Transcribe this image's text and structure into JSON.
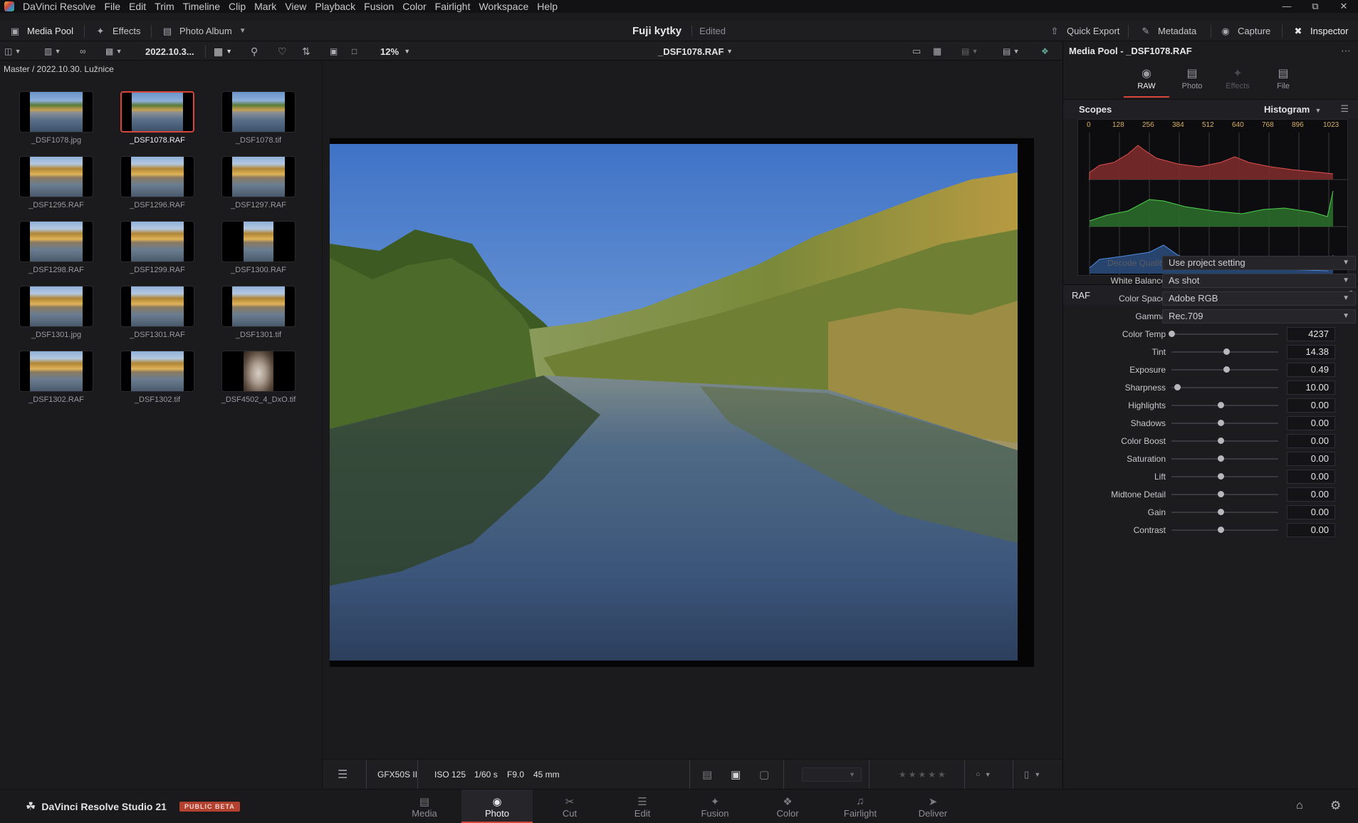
{
  "menubar": {
    "items": [
      "DaVinci Resolve",
      "File",
      "Edit",
      "Trim",
      "Timeline",
      "Clip",
      "Mark",
      "View",
      "Playback",
      "Fusion",
      "Color",
      "Fairlight",
      "Workspace",
      "Help"
    ]
  },
  "toolbar": {
    "media_pool": "Media Pool",
    "effects": "Effects",
    "photo_album": "Photo Album",
    "project_title": "Fuji kytky",
    "edited": "Edited",
    "quick_export": "Quick Export",
    "metadata": "Metadata",
    "capture": "Capture",
    "inspector": "Inspector"
  },
  "subbar": {
    "bin": "2022.10.3...",
    "zoom": "12%",
    "clip_name": "_DSF1078.RAF"
  },
  "pool": {
    "breadcrumb": "Master / 2022.10.30. Lužnice",
    "items": [
      {
        "name": "_DSF1078.jpg",
        "selected": false
      },
      {
        "name": "_DSF1078.RAF",
        "selected": true
      },
      {
        "name": "_DSF1078.tif",
        "selected": false
      },
      {
        "name": "_DSF1295.RAF",
        "selected": false
      },
      {
        "name": "_DSF1296.RAF",
        "selected": false
      },
      {
        "name": "_DSF1297.RAF",
        "selected": false
      },
      {
        "name": "_DSF1298.RAF",
        "selected": false
      },
      {
        "name": "_DSF1299.RAF",
        "selected": false
      },
      {
        "name": "_DSF1300.RAF",
        "selected": false
      },
      {
        "name": "_DSF1301.jpg",
        "selected": false
      },
      {
        "name": "_DSF1301.RAF",
        "selected": false
      },
      {
        "name": "_DSF1301.tif",
        "selected": false
      },
      {
        "name": "_DSF1302.RAF",
        "selected": false
      },
      {
        "name": "_DSF1302.tif",
        "selected": false
      },
      {
        "name": "_DSF4502_4_DxO.tif",
        "selected": false
      }
    ]
  },
  "viewer_bar": {
    "camera": "GFX50S II",
    "iso": "ISO 125",
    "shutter": "1/60 s",
    "aperture": "F9.0",
    "focal": "45 mm"
  },
  "inspector": {
    "title": "Media Pool - _DSF1078.RAF",
    "tabs": [
      {
        "label": "RAW",
        "state": "active",
        "icon": "raw-camera-icon"
      },
      {
        "label": "Photo",
        "state": "normal",
        "icon": "photo-icon"
      },
      {
        "label": "Effects",
        "state": "disabled",
        "icon": "effects-wand-icon"
      },
      {
        "label": "File",
        "state": "normal",
        "icon": "file-icon"
      }
    ],
    "scopes_label": "Scopes",
    "scope_type": "Histogram",
    "histogram_ticks": [
      "0",
      "128",
      "256",
      "384",
      "512",
      "640",
      "768",
      "896",
      "1023"
    ],
    "section": "RAF",
    "dropdowns": [
      {
        "label": "Decode Quality",
        "value": "Use project setting",
        "dim": true
      },
      {
        "label": "White Balance",
        "value": "As shot",
        "dim": false
      },
      {
        "label": "Color Space",
        "value": "Adobe RGB",
        "dim": false
      },
      {
        "label": "Gamma",
        "value": "Rec.709",
        "dim": false
      }
    ],
    "sliders": [
      {
        "label": "Color Temp",
        "value": "4237",
        "pos": 0.0
      },
      {
        "label": "Tint",
        "value": "14.38",
        "pos": 0.51
      },
      {
        "label": "Exposure",
        "value": "0.49",
        "pos": 0.51
      },
      {
        "label": "Sharpness",
        "value": "10.00",
        "pos": 0.05
      },
      {
        "label": "Highlights",
        "value": "0.00",
        "pos": 0.46
      },
      {
        "label": "Shadows",
        "value": "0.00",
        "pos": 0.46
      },
      {
        "label": "Color Boost",
        "value": "0.00",
        "pos": 0.46
      },
      {
        "label": "Saturation",
        "value": "0.00",
        "pos": 0.46
      },
      {
        "label": "Lift",
        "value": "0.00",
        "pos": 0.46
      },
      {
        "label": "Midtone Detail",
        "value": "0.00",
        "pos": 0.46
      },
      {
        "label": "Gain",
        "value": "0.00",
        "pos": 0.46
      },
      {
        "label": "Contrast",
        "value": "0.00",
        "pos": 0.46
      }
    ]
  },
  "pagebar": {
    "brand": "DaVinci Resolve Studio 21",
    "beta": "PUBLIC BETA",
    "pages": [
      {
        "label": "Media",
        "icon": "media-page-icon"
      },
      {
        "label": "Photo",
        "icon": "photo-page-icon",
        "active": true
      },
      {
        "label": "Cut",
        "icon": "cut-page-icon"
      },
      {
        "label": "Edit",
        "icon": "edit-page-icon"
      },
      {
        "label": "Fusion",
        "icon": "fusion-page-icon"
      },
      {
        "label": "Color",
        "icon": "color-page-icon"
      },
      {
        "label": "Fairlight",
        "icon": "fairlight-page-icon"
      },
      {
        "label": "Deliver",
        "icon": "deliver-page-icon"
      }
    ]
  },
  "colors": {
    "accent": "#d9453a",
    "panel": "#1c1c1f",
    "background": "#1b1b1e"
  }
}
